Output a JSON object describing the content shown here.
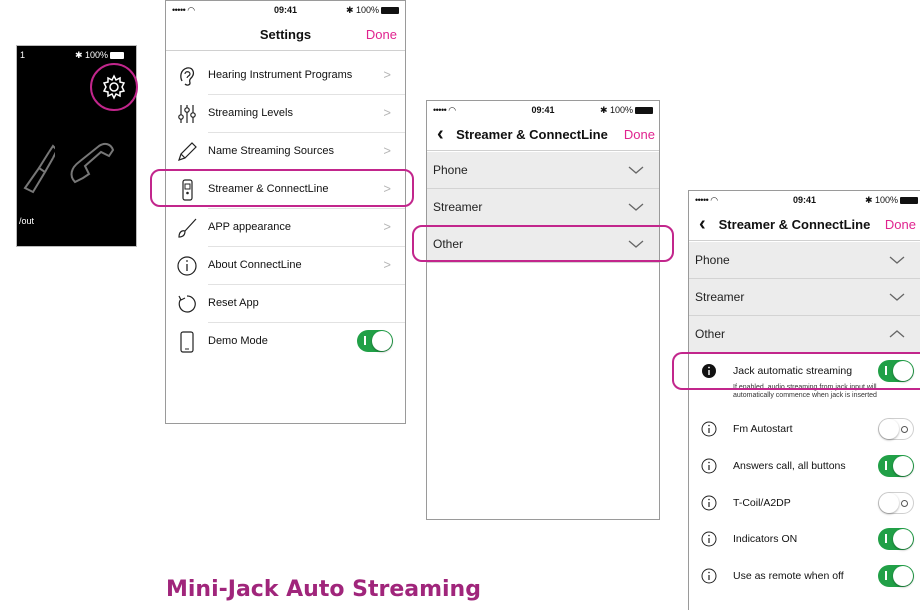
{
  "device": {
    "status_left": "1",
    "status_right": "✱ 100%",
    "label_bottom": "/out",
    "settings_icon": "gear-icon",
    "jack_icon": "jack-icon",
    "phone_icon": "phone-icon"
  },
  "status_bar": {
    "signal": "••••• ◠",
    "time": "09:41",
    "battery": "✱ 100%"
  },
  "settings_screen": {
    "title": "Settings",
    "done_label": "Done",
    "items": [
      {
        "label": "Hearing Instrument Programs",
        "icon": "ear-icon",
        "chevron": ">"
      },
      {
        "label": "Streaming Levels",
        "icon": "sliders-icon",
        "chevron": ">"
      },
      {
        "label": "Name Streaming Sources",
        "icon": "pencil-icon",
        "chevron": ">"
      },
      {
        "label": "Streamer & ConnectLine",
        "icon": "streamer-icon",
        "chevron": ">"
      },
      {
        "label": "APP appearance",
        "icon": "brush-icon",
        "chevron": ">"
      },
      {
        "label": "About ConnectLine",
        "icon": "info-icon",
        "chevron": ">"
      },
      {
        "label": "Reset App",
        "icon": "reset-icon",
        "chevron": ""
      },
      {
        "label": "Demo Mode",
        "icon": "phone-device-icon",
        "toggle": "on"
      }
    ]
  },
  "streamer_screen": {
    "title": "Streamer & ConnectLine",
    "done_label": "Done",
    "sections": [
      {
        "label": "Phone",
        "expanded": false
      },
      {
        "label": "Streamer",
        "expanded": false
      },
      {
        "label": "Other",
        "expanded": false
      }
    ]
  },
  "expanded_screen": {
    "title": "Streamer & ConnectLine",
    "done_label": "Done",
    "sections": [
      {
        "label": "Phone",
        "expanded": false
      },
      {
        "label": "Streamer",
        "expanded": false
      },
      {
        "label": "Other",
        "expanded": true
      }
    ],
    "settings": [
      {
        "label": "Jack automatic streaming",
        "toggle": "on",
        "icon": "info-filled-icon"
      },
      {
        "label": "Fm Autostart",
        "toggle": "off",
        "icon": "info-icon"
      },
      {
        "label": "Answers call, all buttons",
        "toggle": "on",
        "icon": "info-icon"
      },
      {
        "label": "T-Coil/A2DP",
        "toggle": "off",
        "icon": "info-icon"
      },
      {
        "label": "Indicators ON",
        "toggle": "on",
        "icon": "info-icon"
      },
      {
        "label": "Use as remote when off",
        "toggle": "on",
        "icon": "info-icon"
      }
    ],
    "jack_description": "If enabled, audio streaming from jack input will automatically commence when jack is inserted"
  },
  "caption": "Mini-Jack Auto Streaming",
  "colors": {
    "accent": "#e0238f",
    "highlight": "#c2268c",
    "toggle_on": "#21a047",
    "caption": "#a0257b"
  }
}
